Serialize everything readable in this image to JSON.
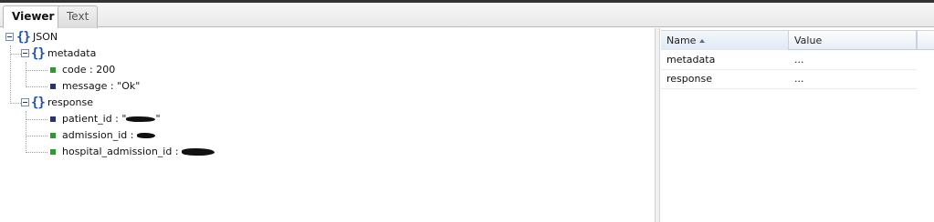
{
  "tabs": [
    {
      "label": "Viewer",
      "active": true
    },
    {
      "label": "Text",
      "active": false
    }
  ],
  "tree": {
    "root": {
      "label": "JSON"
    },
    "metadata": {
      "label": "metadata",
      "children": [
        {
          "label": "code : 200",
          "color": "green"
        },
        {
          "label": "message : \"Ok\"",
          "color": "blue"
        }
      ]
    },
    "response": {
      "label": "response",
      "children": [
        {
          "label": "patient_id : \"",
          "label_tail": "\"",
          "color": "blue",
          "redacted": true
        },
        {
          "label": "admission_id : ",
          "color": "green",
          "redacted": true
        },
        {
          "label": "hospital_admission_id : ",
          "color": "green",
          "redacted": true
        }
      ]
    }
  },
  "grid": {
    "columns": {
      "name": "Name",
      "value": "Value"
    },
    "rows": [
      {
        "name": "metadata",
        "value": "..."
      },
      {
        "name": "response",
        "value": "..."
      }
    ]
  },
  "colors": {
    "leaf_green": "#2e9a2e",
    "leaf_blue": "#23347a",
    "brace": "#1f4fa8"
  },
  "icons": {
    "toggle": "collapse-minus-icon",
    "object": "curly-brace-icon",
    "leaf": "square-bullet-icon",
    "sort": "sort-ascending-icon"
  }
}
